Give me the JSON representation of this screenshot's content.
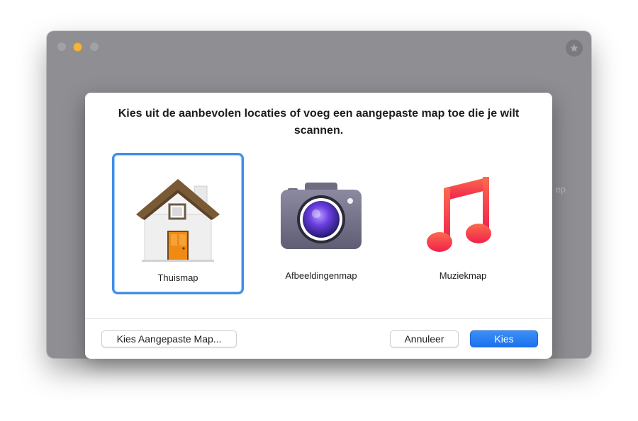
{
  "background_window": {
    "side_text": "ep",
    "star_icon": "star-icon"
  },
  "dialog": {
    "title": "Kies uit de aanbevolen locaties of voeg een aangepaste map toe die je wilt scannen.",
    "locations": [
      {
        "label": "Thuismap",
        "icon": "home-folder-icon",
        "selected": true
      },
      {
        "label": "Afbeeldingenmap",
        "icon": "camera-icon",
        "selected": false
      },
      {
        "label": "Muziekmap",
        "icon": "music-note-icon",
        "selected": false
      }
    ],
    "buttons": {
      "custom_label": "Kies Aangepaste Map...",
      "cancel_label": "Annuleer",
      "choose_label": "Kies"
    }
  },
  "colors": {
    "accent": "#1d72ee",
    "selection_border": "#3d8fe8",
    "window_gray": "#8f8e93",
    "minimize_yellow": "#f4b33a"
  }
}
